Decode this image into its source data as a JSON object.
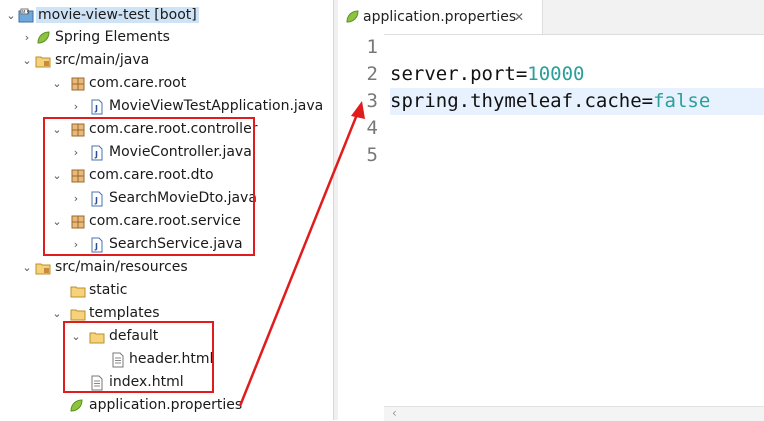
{
  "project_tree": {
    "project": "movie-view-test [boot]",
    "spring_elements": "Spring Elements",
    "src_main_java": "src/main/java",
    "pkg_root": "com.care.root",
    "file_app": "MovieViewTestApplication.java",
    "pkg_controller": "com.care.root.controller",
    "file_controller": "MovieController.java",
    "pkg_dto": "com.care.root.dto",
    "file_dto": "SearchMovieDto.java",
    "pkg_service": "com.care.root.service",
    "file_service": "SearchService.java",
    "src_main_resources": "src/main/resources",
    "folder_static": "static",
    "folder_templates": "templates",
    "folder_default": "default",
    "file_header": "header.html",
    "file_index": "index.html",
    "file_properties": "application.properties"
  },
  "editor": {
    "tab_label": "application.properties",
    "close_glyph": "✕",
    "line_numbers": [
      "1",
      "2",
      "3",
      "4",
      "5"
    ],
    "line2_key": "server.port=",
    "line2_value": "10000",
    "line3_key": "spring.thymeleaf.cache=",
    "line3_value": "false"
  },
  "colors": {
    "annotation_red": "#e01c1c",
    "value_teal": "#2a9f9a",
    "selection_blue": "#cfe3f7"
  },
  "icons": {
    "project": "boot-project-icon",
    "spring": "spring-leaf-icon",
    "source_folder": "source-folder-icon",
    "package": "package-icon",
    "java_file": "java-file-icon",
    "folder": "folder-icon",
    "html_file": "html-file-icon",
    "properties_file": "properties-file-icon"
  }
}
